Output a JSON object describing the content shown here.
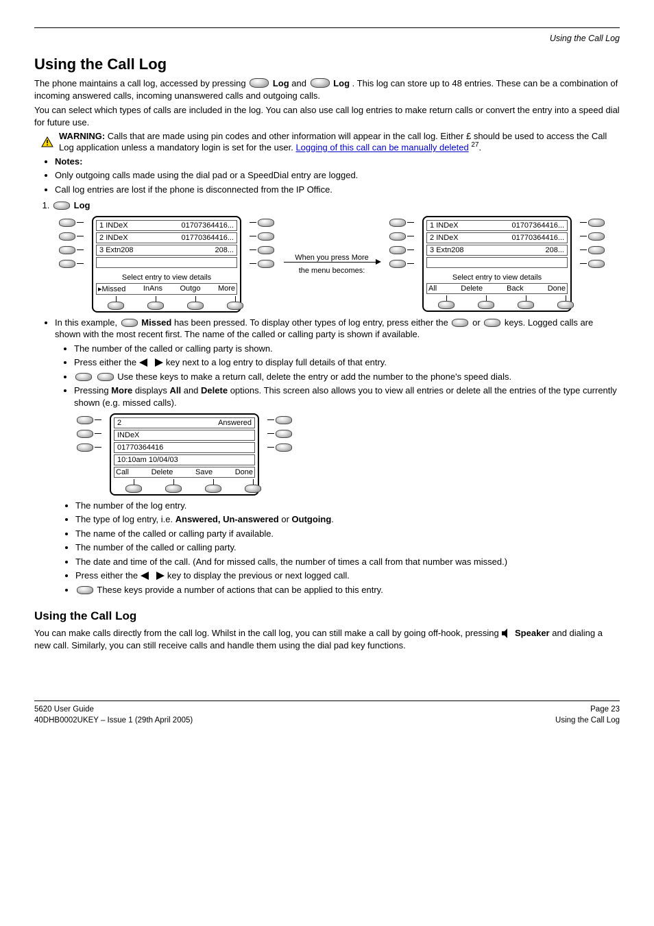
{
  "header": {
    "right_title": "Using the Call Log"
  },
  "section": {
    "title": "Using the Call Log",
    "intro_1_prefix": "The phone maintains a call log, accessed by pressing ",
    "intro_1_buttons_join": " and ",
    "intro_1_mid": ". This log can store up to 48 entries. These can be a combination of incoming answered calls, incoming unanswered calls and outgoing calls.",
    "intro_2": "You can select which types of calls are included in the log. You can also use call log entries to make return calls or convert the entry into a speed dial for future use.",
    "log_label": "Log",
    "log_btn": "Log",
    "warn_title": "WARNING:",
    "warn_text": " Calls that are made using pin codes and other information will appear in the call log. Either £ should be used to access the Call Log application unless a mandatory login is set for the user."
  },
  "notes": [
    {
      "prefix": "Only outgoing calls made using the dial pad or a SpeedDial entry are logged."
    },
    {
      "prefix": "Call log entries are lost if the phone is disconnected from the IP Office."
    },
    {
      "prefix_bold": "Notes: "
    }
  ],
  "note_link_text": "Logging of this call can be manually deleted",
  "note_link_ref": "27",
  "lcd1": {
    "rows": [
      {
        "idx": "1",
        "name": "INDeX",
        "num": "01707364416..."
      },
      {
        "idx": "2",
        "name": "INDeX",
        "num": "01770364416..."
      },
      {
        "idx": "3",
        "name": "Extn208",
        "num": "208..."
      }
    ],
    "hint": "Select entry to view details",
    "softkeys": [
      "Missed",
      "InAns",
      "Outgo",
      "More"
    ]
  },
  "between": {
    "l1": "When you press More",
    "l2": "the menu becomes:"
  },
  "lcd2": {
    "rows": [
      {
        "idx": "1",
        "name": "INDeX",
        "num": "01707364416..."
      },
      {
        "idx": "2",
        "name": "INDeX",
        "num": "01770364416..."
      },
      {
        "idx": "3",
        "name": "Extn208",
        "num": "208..."
      }
    ],
    "hint": "Select entry to view details",
    "softkeys": [
      "All",
      "Delete",
      "Back",
      "Done"
    ]
  },
  "big_blank_lcd": {
    "row1_left": "10:10am  10/04/03",
    "row1_right": "Answered",
    "idx": "2",
    "name": "INDeX",
    "num": "01770364416",
    "softkeys": [
      "Call",
      "Delete",
      "Save",
      "Done"
    ]
  },
  "use_section": {
    "lead_prefix": "In this example, ",
    "lead_missed": "Missed",
    "lead_mid": " has been pressed. To display other types of log entry, press either the ",
    "lead_or": " or ",
    "lead_after": " keys. Logged calls are shown with the most recent first. The name of the called or calling party is shown if available.",
    "lead_next": "The number of the called or calling party is shown.",
    "b3_prefix": "Press either the ",
    "b3_suffix": " key next to a log entry to display full details of that entry.",
    "b4_prefix": "Use these keys to make a return call, delete the entry or add the number to the phone's speed dials.",
    "b5_prefix": "Pressing ",
    "b5_more": "More",
    "b5_mid": " displays ",
    "b5_all": "All",
    "b5_and": " and ",
    "b5_del": "Delete",
    "b5_rest": " options. This screen also allows you to view all entries or delete all the entries of the type currently shown (e.g. missed calls)."
  },
  "use_block2": {
    "line1": "The number of the log entry.",
    "line2": "The type of log entry, i.e. ",
    "line2_terms": "Answered, Un-answered",
    "line2_or": " or ",
    "line2_out": "Outgoing",
    "line3": "The name of the called or calling party if available.",
    "line4": "The number of the called or calling party.",
    "line5": "The date and time of the call. (And for missed calls, the number of times a call from that number was missed.)",
    "line6_prefix": "Press either the ",
    "line6_suffix": " key to display the previous or next logged call.",
    "line7": " These keys provide a number of actions that can be applied to this entry."
  },
  "call": {
    "title": "Using the Call Log",
    "intro_prefix": "You can make calls directly from the call log.  Whilst in the call log, you can still make a call by going off-hook, pressing ",
    "intro_after": " and dialing a new call. Similarly, you can still receive calls and handle them using the dial pad key functions.",
    "speaker_label": "Speaker"
  },
  "footer": {
    "left": "5620 User Guide",
    "right": "Page 23",
    "line2_left": "40DHB0002UKEY – Issue 1 (29th April 2005)",
    "line2_right": "Using the Call Log"
  }
}
